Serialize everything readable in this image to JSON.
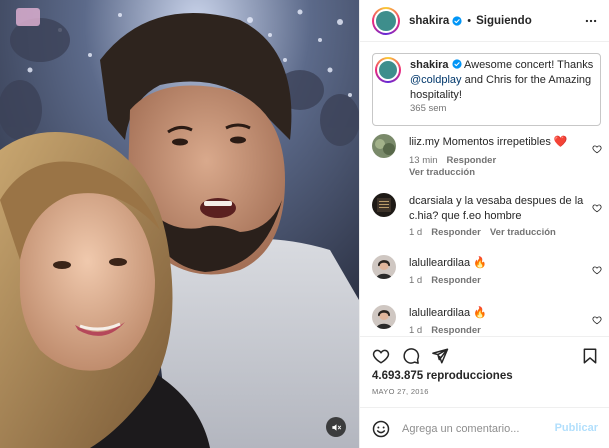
{
  "header": {
    "username": "shakira",
    "separator": "•",
    "follow_label": "Siguiendo"
  },
  "caption": {
    "username": "shakira",
    "text_before": " Awesome concert! Thanks ",
    "mention": "@coldplay",
    "text_after": " and Chris for the Amazing hospitality!",
    "time": "365 sem"
  },
  "comments": [
    {
      "username": "liiz.my",
      "text": " Momentos irrepetibles ❤️",
      "time": "13 min",
      "reply": "Responder",
      "translate": "Ver traducción"
    },
    {
      "username": "dcarsiala",
      "text": " y la vesaba despues de la c.hia? que f.eo hombre",
      "time": "1 d",
      "reply": "Responder",
      "translate": "Ver traducción"
    },
    {
      "username": "lalulleardilaa",
      "text": " 🔥",
      "time": "1 d",
      "reply": "Responder"
    },
    {
      "username": "lalulleardilaa",
      "text": " 🔥",
      "time": "1 d",
      "reply": "Responder"
    }
  ],
  "stats": {
    "views": "4.693.875 reproducciones",
    "date": "MAYO 27, 2016"
  },
  "add_comment": {
    "placeholder": "Agrega un comentario...",
    "publish_label": "Publicar"
  },
  "colors": {
    "link": "#00376b",
    "verified": "#0095f6",
    "muted": "#737373",
    "publish_disabled": "#b2dffc"
  }
}
